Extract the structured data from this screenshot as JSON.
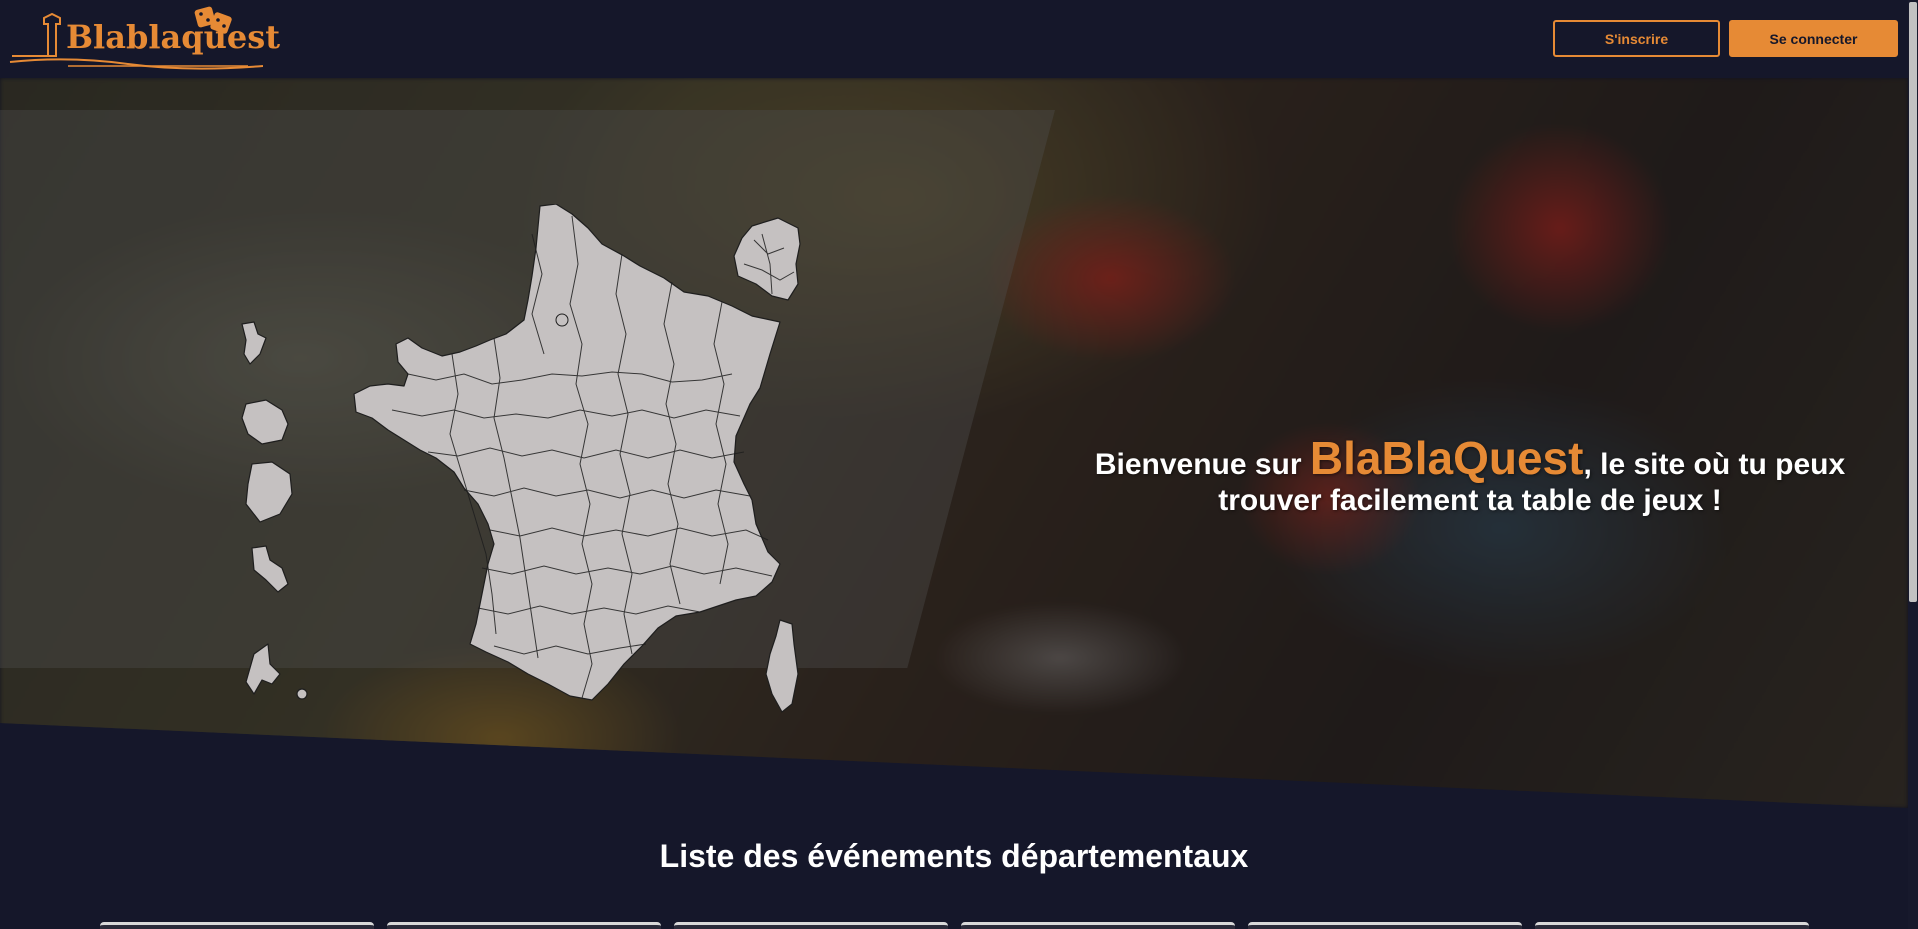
{
  "header": {
    "logo_text": "Blablaquest",
    "signup_label": "S'inscrire",
    "login_label": "Se connecter"
  },
  "hero": {
    "welcome_prefix": "Bienvenue sur ",
    "brand": "BlaBlaQuest",
    "welcome_suffix_1": ", le site où tu peux",
    "welcome_suffix_2": "trouver facilement ta table de jeux !"
  },
  "events": {
    "title": "Liste des événements départementaux",
    "card_count": 6
  },
  "colors": {
    "accent": "#e68a35",
    "background": "#15172a",
    "map_fill": "#c5c1c1"
  }
}
